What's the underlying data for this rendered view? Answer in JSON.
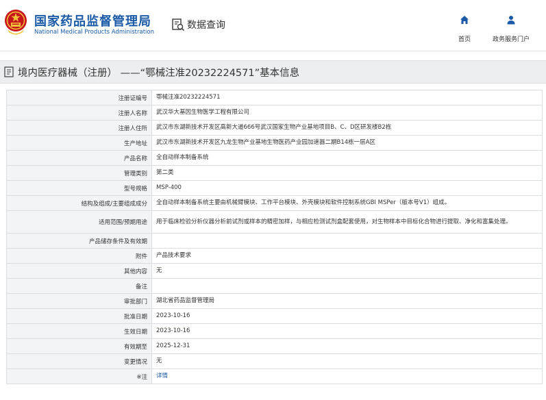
{
  "header": {
    "logo_cn": "国家药品监督管理局",
    "logo_en": "National Medical Products Administration",
    "query_label": "数据查询",
    "nav": [
      {
        "label": "首页",
        "icon": "home-icon"
      },
      {
        "label": "政务服务门户",
        "icon": "user-icon"
      }
    ],
    "brand_color": "#1a5aa6"
  },
  "title": "境内医疗器械（注册） ——“鄂械注准20232224571”基本信息",
  "rows": [
    {
      "key": "注册证编号",
      "value": "鄂械注准20232224571"
    },
    {
      "key": "注册人名称",
      "value": "武汉华大基因生物医学工程有限公司"
    },
    {
      "key": "注册人住所",
      "value": "武汉市东湖新技术开发区高新大道666号武汉国家生物产业基地项目B、C、D区研发楼B2栋"
    },
    {
      "key": "生产地址",
      "value": "武汉市东湖新技术开发区九龙生物产业基地生物医药产业园加速器二期B14栋一层A区"
    },
    {
      "key": "产品名称",
      "value": "全自动样本制备系统"
    },
    {
      "key": "管理类别",
      "value": "第二类"
    },
    {
      "key": "型号规格",
      "value": "MSP-400"
    },
    {
      "key": "结构及组成/主要组成成分",
      "value": "全自动样本制备系统主要由机械臂模块、工作平台模块、外壳模块和软件控制系统GBI MSPer（版本号V1）组成。"
    },
    {
      "key": "适用范围/预期用途",
      "value": "用于临床检验分析仪器分析前试剂或样本的精密加样，与相应检测试剂盒配套使用，对生物样本中目标化合物进行提取、净化和富集处理。",
      "tall": true
    },
    {
      "key": "产品储存条件及有效期",
      "value": ""
    },
    {
      "key": "附件",
      "value": "产品技术要求"
    },
    {
      "key": "其他内容",
      "value": "无"
    },
    {
      "key": "备注",
      "value": ""
    },
    {
      "key": "审批部门",
      "value": "湖北省药品监督管理局"
    },
    {
      "key": "批准日期",
      "value": "2023-10-16"
    },
    {
      "key": "生效日期",
      "value": "2023-10-16"
    },
    {
      "key": "有效期至",
      "value": "2025-12-31"
    },
    {
      "key": "变更情况",
      "value": "无"
    },
    {
      "key": "※注",
      "value": "详情",
      "link": true
    }
  ]
}
